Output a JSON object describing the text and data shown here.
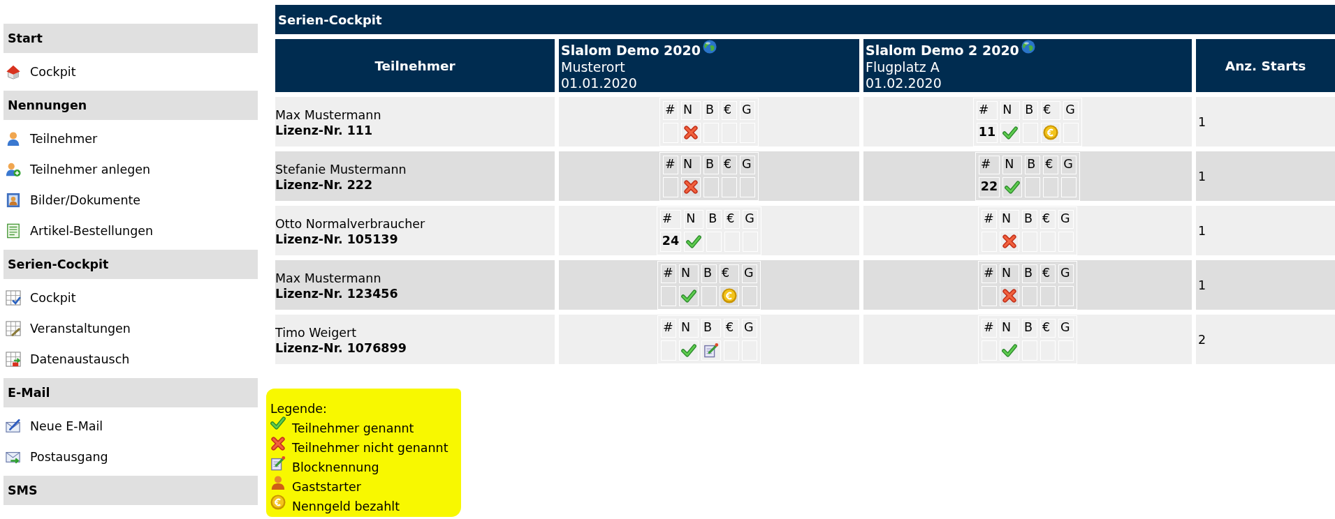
{
  "sidebar": {
    "sections": [
      {
        "title": "Start",
        "items": [
          {
            "label": "Cockpit"
          }
        ]
      },
      {
        "title": "Nennungen",
        "items": [
          {
            "label": "Teilnehmer"
          },
          {
            "label": "Teilnehmer anlegen"
          },
          {
            "label": "Bilder/Dokumente"
          },
          {
            "label": "Artikel-Bestellungen"
          }
        ]
      },
      {
        "title": "Serien-Cockpit",
        "items": [
          {
            "label": "Cockpit"
          },
          {
            "label": "Veranstaltungen"
          },
          {
            "label": "Datenaustausch"
          }
        ]
      },
      {
        "title": "E-Mail",
        "items": [
          {
            "label": "Neue E-Mail"
          },
          {
            "label": "Postausgang"
          }
        ]
      },
      {
        "title": "SMS"
      }
    ]
  },
  "page_title": "Serien-Cockpit",
  "table": {
    "columns": {
      "participant": "Teilnehmer",
      "events": [
        {
          "title": "Slalom Demo 2020",
          "place": "Musterort",
          "date": "01.01.2020"
        },
        {
          "title": "Slalom Demo 2 2020",
          "place": "Flugplatz A",
          "date": "01.02.2020"
        }
      ],
      "starts": "Anz. Starts"
    },
    "rows": [
      {
        "name": "Max Mustermann",
        "license": "Lizenz-Nr. 111",
        "entries": [
          {
            "headers": [
              "#",
              "N",
              "B",
              "€",
              "G"
            ],
            "nominated": false,
            "block_entry": false,
            "paid": false,
            "guest": false
          },
          {
            "headers": [
              "#",
              "N",
              "B",
              "€",
              "G"
            ],
            "number": "11",
            "nominated": true,
            "block_entry": false,
            "paid": true,
            "guest": false
          }
        ],
        "starts": "1"
      },
      {
        "name": "Stefanie Mustermann",
        "license": "Lizenz-Nr. 222",
        "entries": [
          {
            "headers": [
              "#",
              "N",
              "B",
              "€",
              "G"
            ],
            "nominated": false,
            "block_entry": false,
            "paid": false,
            "guest": false
          },
          {
            "headers": [
              "#",
              "N",
              "B",
              "€",
              "G"
            ],
            "number": "22",
            "nominated": true,
            "block_entry": false,
            "paid": false,
            "guest": false
          }
        ],
        "starts": "1"
      },
      {
        "name": "Otto Normalverbraucher",
        "license": "Lizenz-Nr. 105139",
        "entries": [
          {
            "headers": [
              "#",
              "N",
              "B",
              "€",
              "G"
            ],
            "number": "24",
            "nominated": true,
            "block_entry": false,
            "paid": false,
            "guest": false
          },
          {
            "headers": [
              "#",
              "N",
              "B",
              "€",
              "G"
            ],
            "nominated": false,
            "block_entry": false,
            "paid": false,
            "guest": false
          }
        ],
        "starts": "1"
      },
      {
        "name": "Max Mustermann",
        "license": "Lizenz-Nr. 123456",
        "entries": [
          {
            "headers": [
              "#",
              "N",
              "B",
              "€",
              "G"
            ],
            "nominated": true,
            "block_entry": false,
            "paid": true,
            "guest": false
          },
          {
            "headers": [
              "#",
              "N",
              "B",
              "€",
              "G"
            ],
            "nominated": false,
            "block_entry": false,
            "paid": false,
            "guest": false
          }
        ],
        "starts": "1"
      },
      {
        "name": "Timo Weigert",
        "license": "Lizenz-Nr. 1076899",
        "entries": [
          {
            "headers": [
              "#",
              "N",
              "B",
              "€",
              "G"
            ],
            "nominated": true,
            "block_entry": true,
            "paid": false,
            "guest": false
          },
          {
            "headers": [
              "#",
              "N",
              "B",
              "€",
              "G"
            ],
            "nominated": true,
            "block_entry": false,
            "paid": false,
            "guest": false
          }
        ],
        "starts": "2"
      }
    ]
  },
  "legend": {
    "title": "Legende:",
    "items": [
      "Teilnehmer genannt",
      "Teilnehmer nicht genannt",
      "Blocknennung",
      "Gaststarter",
      "Nenngeld bezahlt"
    ]
  }
}
